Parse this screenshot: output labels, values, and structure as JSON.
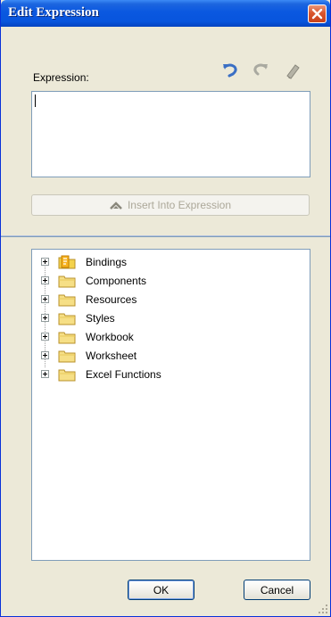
{
  "window": {
    "title": "Edit Expression"
  },
  "expression": {
    "label": "Expression:",
    "value": ""
  },
  "toolbar": {
    "undo_icon": "undo-icon",
    "redo_icon": "redo-icon",
    "clear_icon": "eraser-icon"
  },
  "insert": {
    "label": "Insert Into Expression",
    "icon": "chevron-up-icon"
  },
  "tree": {
    "items": [
      {
        "label": "Bindings",
        "icon": "bindings-folder-icon"
      },
      {
        "label": "Components",
        "icon": "folder-icon"
      },
      {
        "label": "Resources",
        "icon": "folder-icon"
      },
      {
        "label": "Styles",
        "icon": "folder-icon"
      },
      {
        "label": "Workbook",
        "icon": "folder-icon"
      },
      {
        "label": "Worksheet",
        "icon": "folder-icon"
      },
      {
        "label": "Excel Functions",
        "icon": "folder-icon"
      }
    ]
  },
  "buttons": {
    "ok": "OK",
    "cancel": "Cancel"
  },
  "colors": {
    "titlebar": "#0a58e0",
    "close": "#d9562e",
    "dialog": "#ece9d8",
    "border": "#7f9db9"
  }
}
